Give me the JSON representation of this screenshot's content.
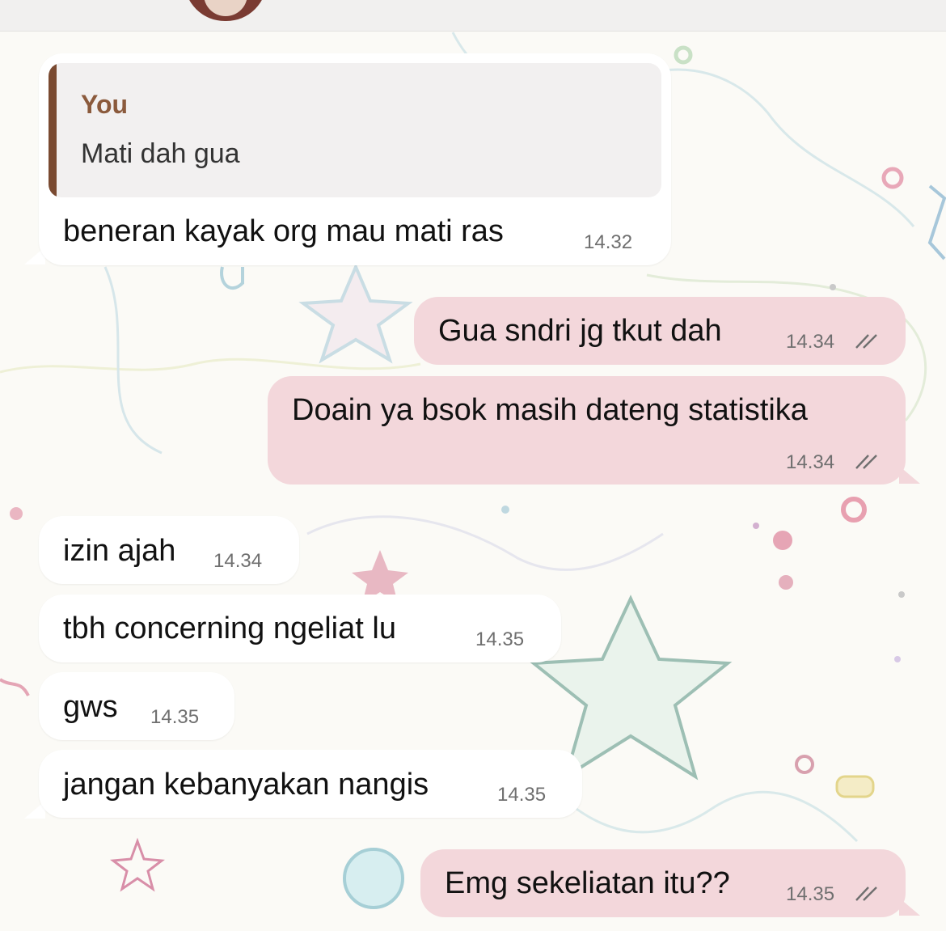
{
  "colors": {
    "incoming_bubble": "#ffffff",
    "outgoing_bubble": "#f3d7db",
    "quote_accent": "#7a4a31",
    "quote_author": "#8b5a3c"
  },
  "header": {
    "avatar_icon": "contact-avatar"
  },
  "messages": [
    {
      "direction": "incoming",
      "reply_to": {
        "author": "You",
        "text": "Mati dah gua"
      },
      "text": "beneran kayak org mau mati ras",
      "time": "14.32"
    },
    {
      "direction": "outgoing",
      "text": "Gua sndri jg tkut dah",
      "time": "14.34",
      "status": "read"
    },
    {
      "direction": "outgoing",
      "text": "Doain ya bsok masih dateng statistika",
      "time": "14.34",
      "status": "read"
    },
    {
      "direction": "incoming",
      "text": "izin ajah",
      "time": "14.34"
    },
    {
      "direction": "incoming",
      "text": "tbh concerning ngeliat lu",
      "time": "14.35"
    },
    {
      "direction": "incoming",
      "text": "gws",
      "time": "14.35"
    },
    {
      "direction": "incoming",
      "text": "jangan kebanyakan nangis",
      "time": "14.35"
    },
    {
      "direction": "outgoing",
      "text": "Emg sekeliatan itu??",
      "time": "14.35",
      "status": "read"
    }
  ]
}
